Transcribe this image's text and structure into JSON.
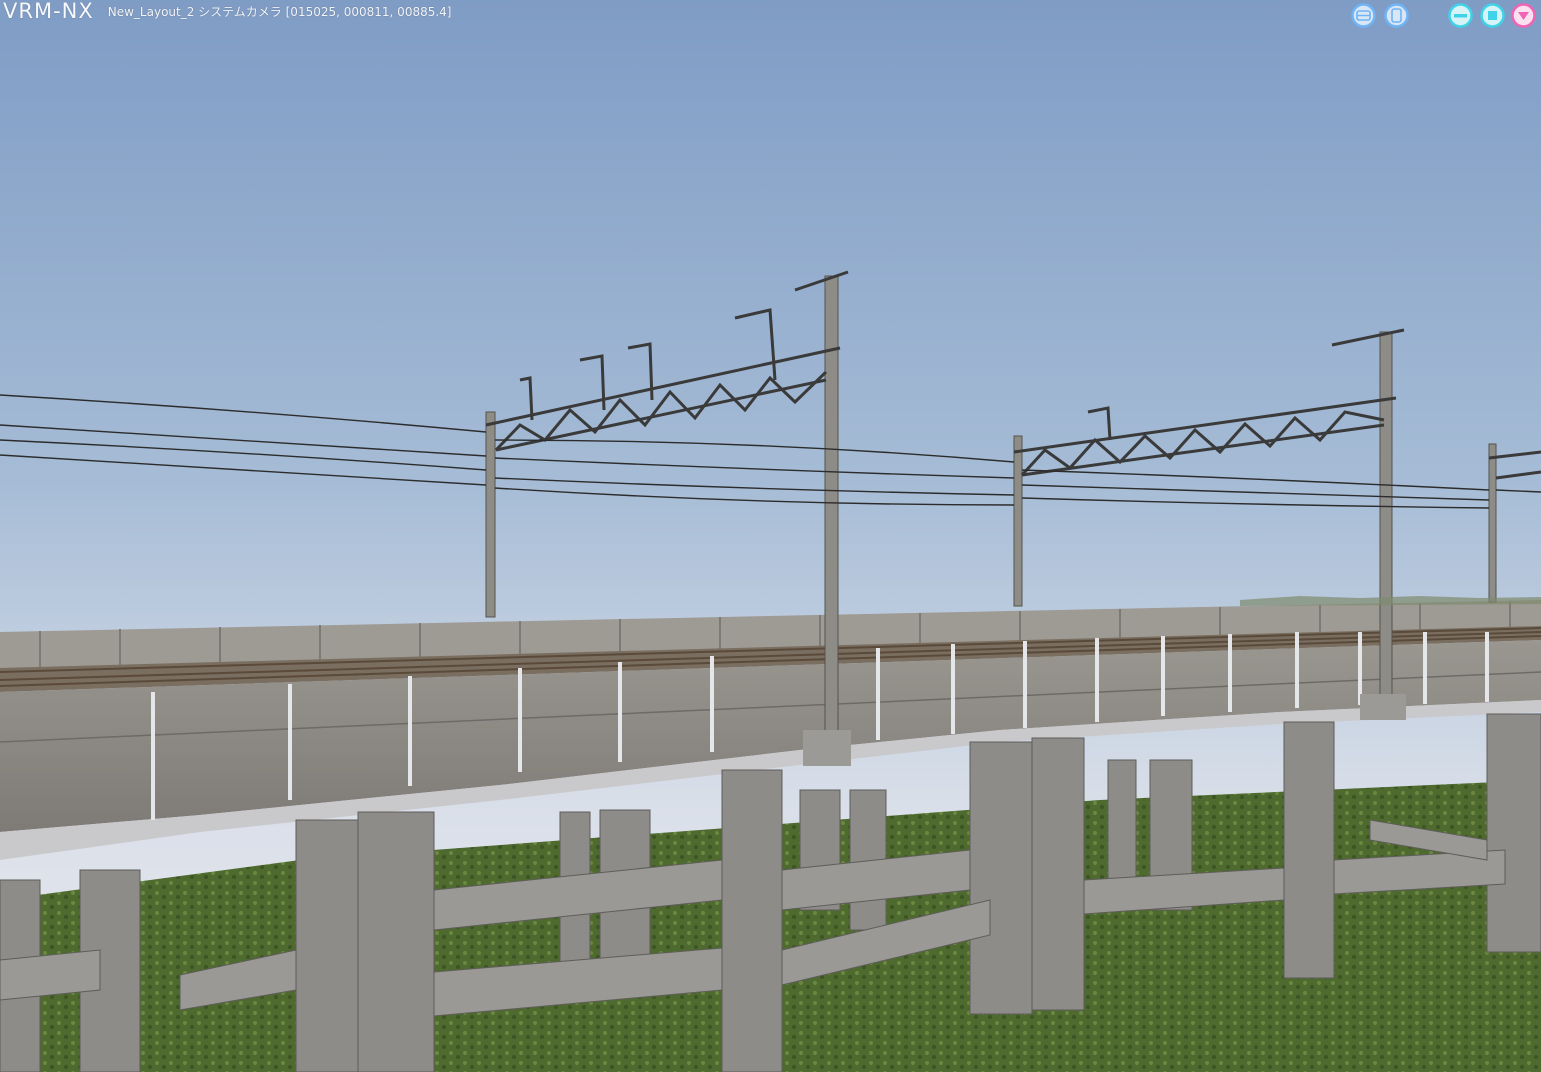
{
  "app": {
    "logo": "VRM-NX",
    "window_title": "New_Layout_2 システムカメラ [015025, 000811, 00885.4]"
  },
  "window_controls": {
    "left_group": [
      {
        "icon": "view-mode-a-icon",
        "color": "#6fb4f5"
      },
      {
        "icon": "view-mode-b-icon",
        "color": "#6fb4f5"
      }
    ],
    "right_group": [
      {
        "icon": "minimize-icon",
        "color": "#3fd2e8"
      },
      {
        "icon": "maximize-icon",
        "color": "#3fd2e8"
      },
      {
        "icon": "menu-dropdown-icon",
        "color": "#f063b5"
      }
    ]
  },
  "scene": {
    "sky_top": "#7f9cc5",
    "sky_bottom": "#e6e6ee",
    "ground": "#4f6a2f",
    "concrete": "#8c8a86"
  }
}
